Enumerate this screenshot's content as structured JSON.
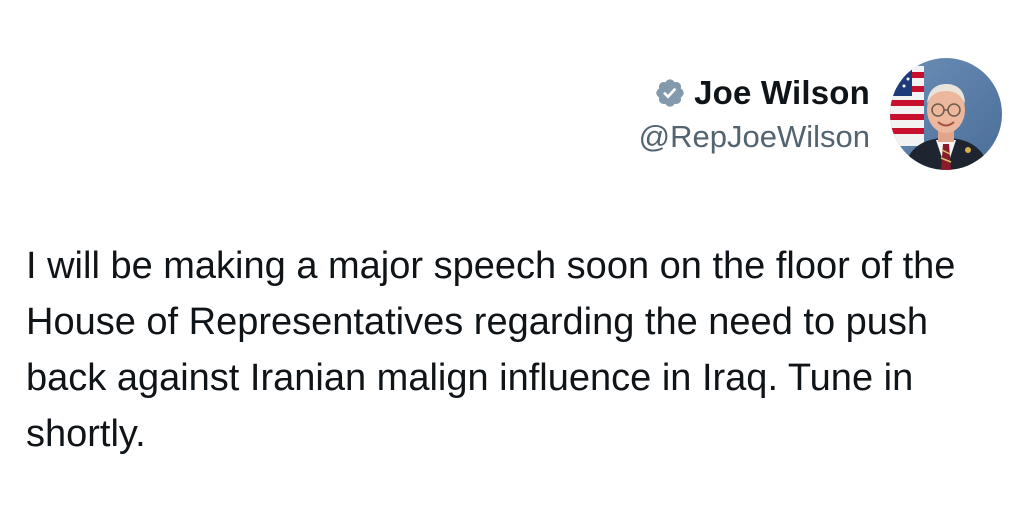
{
  "author": {
    "display_name": "Joe Wilson",
    "handle": "@RepJoeWilson",
    "verified_badge": "verified-badge-icon",
    "badge_color": "#829aab",
    "avatar": "profile-photo"
  },
  "tweet": {
    "text": "I will be making a major speech soon on the floor of the House of Representatives regarding the need to push back against Iranian malign influence in Iraq. Tune in shortly."
  },
  "colors": {
    "primary_text": "#0f1419",
    "secondary_text": "#536471"
  }
}
